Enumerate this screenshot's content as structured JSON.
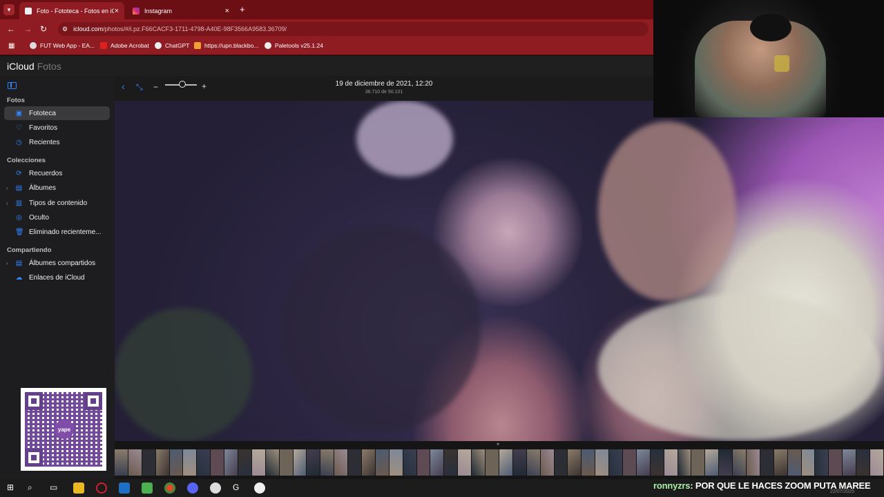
{
  "browser": {
    "tabs": [
      {
        "title": "Foto - Fototeca - Fotos en iClou",
        "active": true
      },
      {
        "title": "Instagram",
        "active": false
      }
    ],
    "new_tab": "+",
    "url_host": "icloud.com",
    "url_path": "/photos/#/i.pz.F66CACF3-1711-4798-A40E-98F3566A9583.36709/",
    "bookmarks": [
      {
        "label": "FUT Web App - EA...",
        "color": "#ffffff"
      },
      {
        "label": "Adobe Acrobat",
        "color": "#e02020"
      },
      {
        "label": "ChatGPT",
        "color": "#ffffff"
      },
      {
        "label": "https://upn.blackbo...",
        "color": "#f0a030"
      },
      {
        "label": "Paletools v25.1.24",
        "color": "#ffffff"
      }
    ]
  },
  "icloud": {
    "brand": "iCloud",
    "app": "Fotos"
  },
  "sidebar": {
    "section_fotos": "Fotos",
    "fotos_items": [
      {
        "label": "Fototeca",
        "icon": "photos-icon",
        "selected": true
      },
      {
        "label": "Favoritos",
        "icon": "heart-icon"
      },
      {
        "label": "Recientes",
        "icon": "clock-icon"
      }
    ],
    "section_colecciones": "Colecciones",
    "colecciones_items": [
      {
        "label": "Recuerdos",
        "icon": "memories-icon"
      },
      {
        "label": "Álbumes",
        "icon": "albums-icon"
      },
      {
        "label": "Tipos de contenido",
        "icon": "media-types-icon"
      },
      {
        "label": "Oculto",
        "icon": "hidden-icon"
      },
      {
        "label": "Eliminado recienteme...",
        "icon": "trash-icon"
      }
    ],
    "section_compartiendo": "Compartiendo",
    "compartiendo_items": [
      {
        "label": "Álbumes compartidos",
        "icon": "shared-albums-icon"
      },
      {
        "label": "Enlaces de iCloud",
        "icon": "cloud-link-icon"
      }
    ]
  },
  "qr": {
    "brand": "yape"
  },
  "viewer": {
    "date": "19 de diciembre de 2021, 12:20",
    "count": "36.710 de 50.101",
    "zoom": 0.55
  },
  "chat": {
    "user": "ronnyzrs",
    "message": ": POR QUE LE HACES ZOOM PUTA MAREE"
  },
  "taskbar": {
    "date_stamp": "22/07/2025"
  },
  "colors": {
    "tab_bar": "#6b0f14",
    "toolbar": "#8f1c22",
    "accent": "#2f86ff"
  }
}
